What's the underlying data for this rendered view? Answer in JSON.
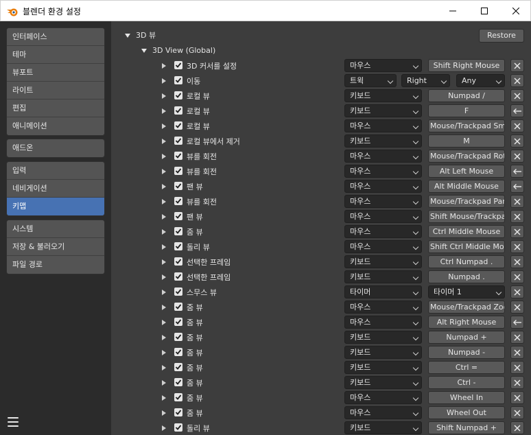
{
  "window": {
    "title": "블렌더 환경 설정"
  },
  "sidebar": {
    "groups": [
      {
        "items": [
          {
            "label": "인터페이스",
            "active": false
          },
          {
            "label": "테마",
            "active": false
          },
          {
            "label": "뷰포트",
            "active": false
          },
          {
            "label": "라이트",
            "active": false
          },
          {
            "label": "편집",
            "active": false
          },
          {
            "label": "애니메이션",
            "active": false
          }
        ]
      },
      {
        "items": [
          {
            "label": "애드온",
            "active": false
          }
        ]
      },
      {
        "items": [
          {
            "label": "입력",
            "active": false
          },
          {
            "label": "네비게이션",
            "active": false
          },
          {
            "label": "키맵",
            "active": true
          }
        ]
      },
      {
        "items": [
          {
            "label": "시스템",
            "active": false
          },
          {
            "label": "저장 & 불러오기",
            "active": false
          },
          {
            "label": "파일 경로",
            "active": false
          }
        ]
      }
    ]
  },
  "main": {
    "section": "3D 뷰",
    "subsection": "3D View (Global)",
    "restore_label": "Restore",
    "rows": [
      {
        "name": "3D 커서를 설정",
        "type": "마우스",
        "key": "Shift Right Mouse",
        "action": "x"
      },
      {
        "name": "이동",
        "type": "트윅",
        "tweak_dir": "Right",
        "tweak_any": "Any",
        "action": "x"
      },
      {
        "name": "로컬 뷰",
        "type": "키보드",
        "key": "Numpad /",
        "action": "x"
      },
      {
        "name": "로컬 뷰",
        "type": "키보드",
        "key": "F",
        "action": "back"
      },
      {
        "name": "로컬 뷰",
        "type": "마우스",
        "key": "Mouse/Trackpad Sm...",
        "action": "x"
      },
      {
        "name": "로컬 뷰에서 제거",
        "type": "키보드",
        "key": "M",
        "action": "x"
      },
      {
        "name": "뷰를 회전",
        "type": "마우스",
        "key": "Mouse/Trackpad Rot...",
        "action": "x"
      },
      {
        "name": "뷰를 회전",
        "type": "마우스",
        "key": "Alt Left Mouse",
        "action": "back"
      },
      {
        "name": "팬 뷰",
        "type": "마우스",
        "key": "Alt Middle Mouse",
        "action": "back"
      },
      {
        "name": "뷰를 회전",
        "type": "마우스",
        "key": "Mouse/Trackpad Pan",
        "action": "x"
      },
      {
        "name": "팬 뷰",
        "type": "마우스",
        "key": "Shift Mouse/Trackpa...",
        "action": "x"
      },
      {
        "name": "줌 뷰",
        "type": "마우스",
        "key": "Ctrl Middle Mouse",
        "action": "x"
      },
      {
        "name": "돌리 뷰",
        "type": "마우스",
        "key": "Shift Ctrl Middle Mo...",
        "action": "x"
      },
      {
        "name": "선택한 프레임",
        "type": "키보드",
        "key": "Ctrl Numpad .",
        "action": "x"
      },
      {
        "name": "선택한 프레임",
        "type": "키보드",
        "key": "Numpad .",
        "action": "x"
      },
      {
        "name": "스무스 뷰",
        "type": "타이머",
        "key": "타이머 1",
        "key_dropdown": true,
        "action": "x"
      },
      {
        "name": "줌 뷰",
        "type": "마우스",
        "key": "Mouse/Trackpad Zoo...",
        "action": "x"
      },
      {
        "name": "줌 뷰",
        "type": "마우스",
        "key": "Alt Right Mouse",
        "action": "back"
      },
      {
        "name": "줌 뷰",
        "type": "키보드",
        "key": "Numpad +",
        "action": "x"
      },
      {
        "name": "줌 뷰",
        "type": "키보드",
        "key": "Numpad -",
        "action": "x"
      },
      {
        "name": "줌 뷰",
        "type": "키보드",
        "key": "Ctrl =",
        "action": "x"
      },
      {
        "name": "줌 뷰",
        "type": "키보드",
        "key": "Ctrl -",
        "action": "x"
      },
      {
        "name": "줌 뷰",
        "type": "마우스",
        "key": "Wheel In",
        "action": "x"
      },
      {
        "name": "줌 뷰",
        "type": "마우스",
        "key": "Wheel Out",
        "action": "x"
      },
      {
        "name": "돌리 뷰",
        "type": "키보드",
        "key": "Shift Numpad +",
        "action": "x"
      }
    ]
  },
  "colors": {
    "accent": "#4772b3",
    "panel": "#3d3d3d",
    "sidebar": "#2b2b2b"
  }
}
